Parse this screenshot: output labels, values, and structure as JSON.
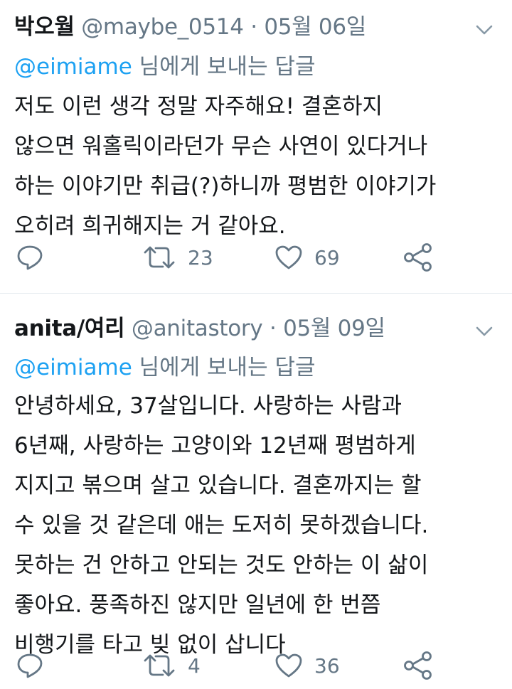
{
  "tweets": [
    {
      "author_name": "박오월",
      "handle": "@maybe_0514",
      "separator": "·",
      "date": "05월 06일",
      "reply_to_handle": "@eimiame",
      "reply_to_suffix": "님에게 보내는 답글",
      "text_lines": [
        "저도 이런 생각 정말 자주해요! 결혼하지",
        "않으면 워홀릭이라던가 무슨 사연이 있다거나",
        "하는 이야기만 취급(?)하니까 평범한 이야기가",
        "오히려 희귀해지는 거 같아요."
      ],
      "retweet_count": "23",
      "like_count": "69"
    },
    {
      "author_name": "anita/여리",
      "handle": "@anitastory",
      "separator": "·",
      "date": "05월 09일",
      "reply_to_handle": "@eimiame",
      "reply_to_suffix": "님에게 보내는 답글",
      "text_lines": [
        "안녕하세요, 37살입니다. 사랑하는 사람과",
        "6년째, 사랑하는 고양이와 12년째 평범하게",
        "지지고 볶으며 살고 있습니다. 결혼까지는 할",
        "수 있을 것 같은데 애는 도저히 못하겠습니다.",
        "못하는 건 안하고 안되는 것도 안하는 이 삶이",
        "좋아요. 풍족하진 않지만 일년에 한 번쯤",
        "비행기를 타고 빚 없이 삽니다"
      ],
      "retweet_count": "4",
      "like_count": "36"
    }
  ],
  "icons": {
    "reply": "reply-icon",
    "retweet": "retweet-icon",
    "like": "heart-icon",
    "share": "share-icon",
    "more": "chevron-down-icon"
  },
  "colors": {
    "text": "#14171a",
    "secondary": "#657786",
    "link": "#1da1f2",
    "divider": "#e6ecf0"
  }
}
